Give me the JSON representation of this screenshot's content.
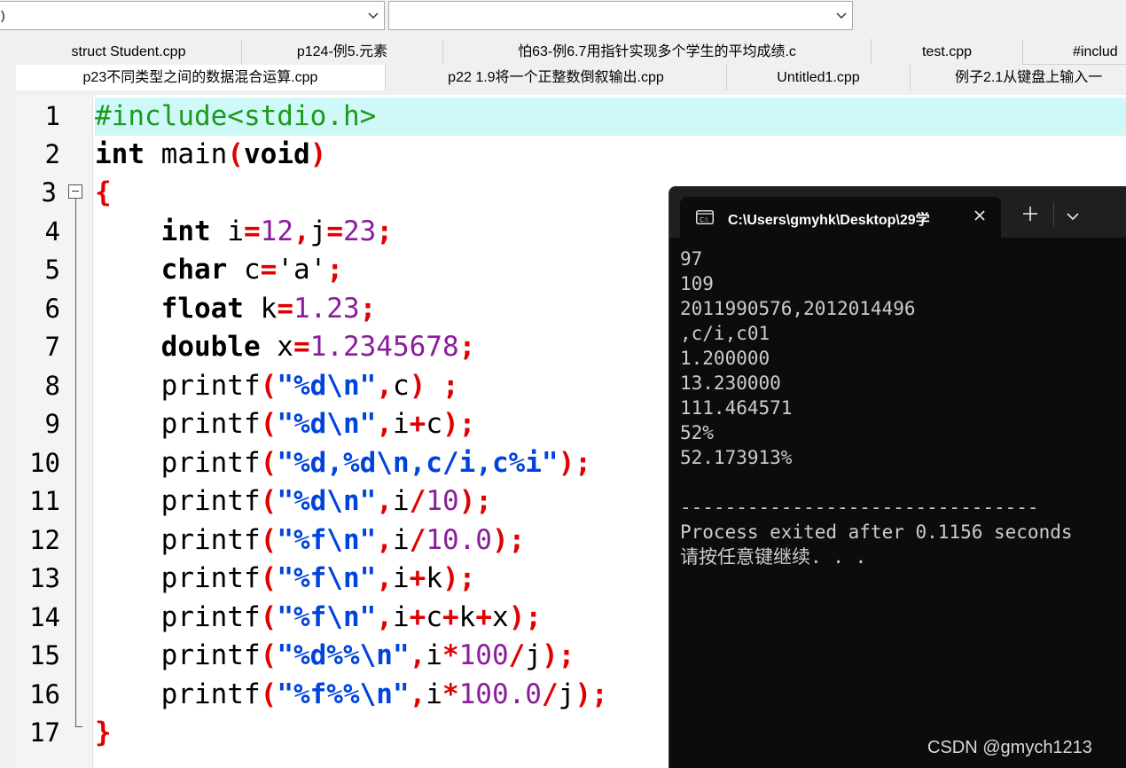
{
  "toolbar": {
    "combo1_value": ")",
    "combo2_value": ""
  },
  "tabs_row1": [
    "struct Student.cpp",
    "p124-例5.元素",
    "怕63-例6.7用指针实现多个学生的平均成绩.c",
    "test.cpp",
    "#includ"
  ],
  "tabs_row2": [
    "p23不同类型之间的数据混合运算.cpp",
    "p22 1.9将一个正整数倒叙输出.cpp",
    "Untitled1.cpp",
    "例子2.1从键盘上输入一"
  ],
  "editor": {
    "line_numbers": [
      "1",
      "2",
      "3",
      "4",
      "5",
      "6",
      "7",
      "8",
      "9",
      "10",
      "11",
      "12",
      "13",
      "14",
      "15",
      "16",
      "17"
    ],
    "line1": "#include<stdio.h>",
    "kw_int": "int",
    "main": " main",
    "kw_void": "void",
    "kw_char": "char",
    "kw_float": "float",
    "kw_double": "double",
    "printf": "printf",
    "brace_open": "{",
    "brace_close": "}"
  },
  "terminal": {
    "tab_title": "C:\\Users\\gmyhk\\Desktop\\29学",
    "lines": [
      "97",
      "109",
      "2011990576,2012014496",
      ",c/i,c01",
      "1.200000",
      "13.230000",
      "111.464571",
      "52%",
      "52.173913%",
      "",
      "--------------------------------",
      "Process exited after 0.1156 seconds",
      "请按任意键继续. . ."
    ]
  },
  "watermark": "CSDN @gmych1213"
}
